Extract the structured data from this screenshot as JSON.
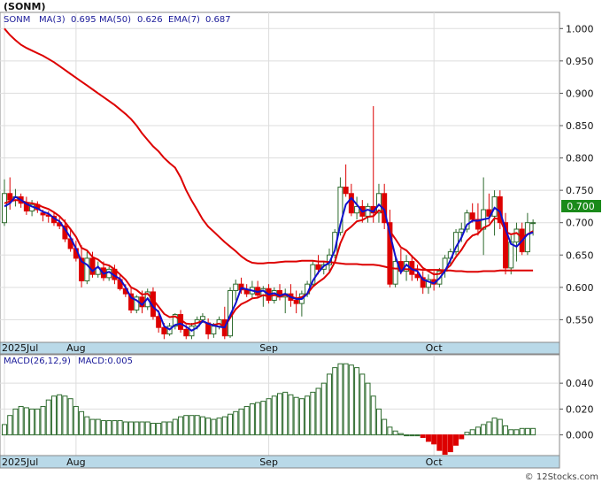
{
  "header": {
    "symbol": "(SONM)",
    "legend_ticker": "SONM",
    "ma3_label": "MA(3)",
    "ma3_value": "0.695",
    "ma50_label": "MA(50)",
    "ma50_value": "0.626",
    "ema7_label": "EMA(7)",
    "ema7_value": "0.687"
  },
  "macd_header": {
    "params": "MACD(26,12,9)",
    "value_label": "MACD:0.005"
  },
  "last_price_badge": "0.700",
  "watermark": "© 12Stocks.com",
  "colors": {
    "up_candle": "#2e6b2e",
    "down_candle": "#dd0000",
    "ma3": "#1111cc",
    "ma50": "#dd0000",
    "ema7": "#dd0000",
    "axis_band": "#b9d9e8",
    "badge": "#1a8a1a"
  },
  "chart_data": [
    {
      "type": "candlestick",
      "title": "",
      "y_ticks": [
        "1.000",
        "0.950",
        "0.900",
        "0.850",
        "0.800",
        "0.750",
        "0.700",
        "0.650",
        "0.600",
        "0.550"
      ],
      "ylim": [
        0.515,
        1.025
      ],
      "x_ticks": [
        "2025Jul",
        "Aug",
        "Sep",
        "Oct"
      ],
      "x_tick_index": [
        0,
        13,
        48,
        78
      ],
      "n": 97,
      "ohlc": [
        [
          0.7,
          0.767,
          0.695,
          0.745
        ],
        [
          0.745,
          0.77,
          0.72,
          0.735
        ],
        [
          0.735,
          0.752,
          0.725,
          0.74
        ],
        [
          0.74,
          0.745,
          0.723,
          0.73
        ],
        [
          0.73,
          0.74,
          0.712,
          0.718
        ],
        [
          0.718,
          0.735,
          0.71,
          0.728
        ],
        [
          0.728,
          0.733,
          0.715,
          0.72
        ],
        [
          0.715,
          0.72,
          0.702,
          0.712
        ],
        [
          0.712,
          0.718,
          0.7,
          0.71
        ],
        [
          0.71,
          0.715,
          0.695,
          0.7
        ],
        [
          0.7,
          0.708,
          0.69,
          0.695
        ],
        [
          0.695,
          0.705,
          0.67,
          0.675
        ],
        [
          0.675,
          0.69,
          0.655,
          0.66
        ],
        [
          0.66,
          0.672,
          0.64,
          0.645
        ],
        [
          0.645,
          0.665,
          0.6,
          0.61
        ],
        [
          0.61,
          0.655,
          0.605,
          0.645
        ],
        [
          0.645,
          0.655,
          0.615,
          0.62
        ],
        [
          0.62,
          0.64,
          0.615,
          0.63
        ],
        [
          0.63,
          0.64,
          0.61,
          0.615
        ],
        [
          0.615,
          0.632,
          0.61,
          0.628
        ],
        [
          0.628,
          0.635,
          0.605,
          0.612
        ],
        [
          0.612,
          0.62,
          0.595,
          0.598
        ],
        [
          0.598,
          0.605,
          0.585,
          0.59
        ],
        [
          0.59,
          0.6,
          0.56,
          0.565
        ],
        [
          0.565,
          0.588,
          0.56,
          0.585
        ],
        [
          0.585,
          0.595,
          0.56,
          0.57
        ],
        [
          0.57,
          0.598,
          0.565,
          0.593
        ],
        [
          0.593,
          0.6,
          0.55,
          0.555
        ],
        [
          0.555,
          0.565,
          0.53,
          0.538
        ],
        [
          0.538,
          0.545,
          0.52,
          0.528
        ],
        [
          0.528,
          0.545,
          0.525,
          0.54
        ],
        [
          0.54,
          0.56,
          0.535,
          0.558
        ],
        [
          0.558,
          0.565,
          0.53,
          0.535
        ],
        [
          0.535,
          0.542,
          0.52,
          0.525
        ],
        [
          0.525,
          0.545,
          0.52,
          0.54
        ],
        [
          0.54,
          0.555,
          0.535,
          0.55
        ],
        [
          0.55,
          0.56,
          0.545,
          0.555
        ],
        [
          0.545,
          0.552,
          0.52,
          0.528
        ],
        [
          0.528,
          0.545,
          0.522,
          0.54
        ],
        [
          0.54,
          0.555,
          0.535,
          0.55
        ],
        [
          0.55,
          0.57,
          0.52,
          0.525
        ],
        [
          0.525,
          0.6,
          0.522,
          0.595
        ],
        [
          0.595,
          0.612,
          0.58,
          0.605
        ],
        [
          0.605,
          0.615,
          0.59,
          0.596
        ],
        [
          0.596,
          0.605,
          0.585,
          0.59
        ],
        [
          0.59,
          0.61,
          0.582,
          0.6
        ],
        [
          0.6,
          0.61,
          0.585,
          0.588
        ],
        [
          0.588,
          0.602,
          0.57,
          0.598
        ],
        [
          0.598,
          0.605,
          0.575,
          0.58
        ],
        [
          0.58,
          0.6,
          0.575,
          0.595
        ],
        [
          0.595,
          0.605,
          0.58,
          0.585
        ],
        [
          0.585,
          0.598,
          0.56,
          0.59
        ],
        [
          0.59,
          0.605,
          0.57,
          0.58
        ],
        [
          0.58,
          0.595,
          0.56,
          0.575
        ],
        [
          0.575,
          0.595,
          0.555,
          0.59
        ],
        [
          0.59,
          0.61,
          0.585,
          0.605
        ],
        [
          0.605,
          0.64,
          0.6,
          0.635
        ],
        [
          0.635,
          0.65,
          0.62,
          0.628
        ],
        [
          0.628,
          0.64,
          0.62,
          0.635
        ],
        [
          0.635,
          0.66,
          0.625,
          0.65
        ],
        [
          0.65,
          0.69,
          0.645,
          0.685
        ],
        [
          0.685,
          0.77,
          0.68,
          0.755
        ],
        [
          0.755,
          0.79,
          0.74,
          0.745
        ],
        [
          0.745,
          0.76,
          0.71,
          0.715
        ],
        [
          0.715,
          0.74,
          0.705,
          0.725
        ],
        [
          0.725,
          0.735,
          0.7,
          0.71
        ],
        [
          0.71,
          0.73,
          0.7,
          0.725
        ],
        [
          0.725,
          0.88,
          0.7,
          0.715
        ],
        [
          0.715,
          0.76,
          0.7,
          0.745
        ],
        [
          0.745,
          0.76,
          0.69,
          0.7
        ],
        [
          0.7,
          0.72,
          0.6,
          0.605
        ],
        [
          0.605,
          0.65,
          0.6,
          0.64
        ],
        [
          0.64,
          0.66,
          0.62,
          0.625
        ],
        [
          0.625,
          0.65,
          0.61,
          0.64
        ],
        [
          0.64,
          0.65,
          0.61,
          0.62
        ],
        [
          0.62,
          0.635,
          0.61,
          0.615
        ],
        [
          0.615,
          0.625,
          0.59,
          0.6
        ],
        [
          0.6,
          0.62,
          0.59,
          0.612
        ],
        [
          0.612,
          0.625,
          0.595,
          0.605
        ],
        [
          0.605,
          0.63,
          0.6,
          0.625
        ],
        [
          0.625,
          0.65,
          0.615,
          0.645
        ],
        [
          0.645,
          0.66,
          0.635,
          0.655
        ],
        [
          0.655,
          0.69,
          0.65,
          0.685
        ],
        [
          0.685,
          0.7,
          0.67,
          0.69
        ],
        [
          0.69,
          0.72,
          0.685,
          0.715
        ],
        [
          0.715,
          0.73,
          0.7,
          0.705
        ],
        [
          0.705,
          0.73,
          0.68,
          0.69
        ],
        [
          0.69,
          0.77,
          0.65,
          0.72
        ],
        [
          0.72,
          0.745,
          0.7,
          0.71
        ],
        [
          0.71,
          0.75,
          0.68,
          0.74
        ],
        [
          0.74,
          0.75,
          0.69,
          0.7
        ],
        [
          0.7,
          0.715,
          0.62,
          0.63
        ],
        [
          0.63,
          0.68,
          0.62,
          0.67
        ],
        [
          0.67,
          0.7,
          0.64,
          0.69
        ],
        [
          0.69,
          0.7,
          0.65,
          0.655
        ],
        [
          0.655,
          0.715,
          0.65,
          0.7
        ],
        [
          0.7,
          0.705,
          0.68,
          0.7
        ]
      ],
      "ma3": [
        0.725,
        0.73,
        0.74,
        0.735,
        0.729,
        0.725,
        0.722,
        0.717,
        0.714,
        0.707,
        0.702,
        0.69,
        0.677,
        0.66,
        0.64,
        0.635,
        0.625,
        0.632,
        0.621,
        0.624,
        0.618,
        0.613,
        0.6,
        0.584,
        0.58,
        0.573,
        0.583,
        0.57,
        0.562,
        0.54,
        0.535,
        0.542,
        0.544,
        0.539,
        0.533,
        0.538,
        0.548,
        0.544,
        0.541,
        0.539,
        0.538,
        0.557,
        0.575,
        0.599,
        0.597,
        0.595,
        0.593,
        0.595,
        0.589,
        0.591,
        0.587,
        0.59,
        0.585,
        0.582,
        0.582,
        0.59,
        0.61,
        0.623,
        0.633,
        0.638,
        0.657,
        0.697,
        0.728,
        0.738,
        0.728,
        0.717,
        0.72,
        0.717,
        0.728,
        0.72,
        0.683,
        0.648,
        0.623,
        0.635,
        0.628,
        0.625,
        0.612,
        0.609,
        0.606,
        0.614,
        0.625,
        0.642,
        0.662,
        0.677,
        0.697,
        0.703,
        0.703,
        0.705,
        0.707,
        0.723,
        0.717,
        0.69,
        0.667,
        0.663,
        0.672,
        0.682,
        0.685
      ],
      "ma50": [
        1.0,
        0.99,
        0.982,
        0.975,
        0.97,
        0.966,
        0.962,
        0.958,
        0.953,
        0.948,
        0.942,
        0.936,
        0.93,
        0.924,
        0.918,
        0.912,
        0.906,
        0.9,
        0.894,
        0.888,
        0.882,
        0.875,
        0.868,
        0.86,
        0.85,
        0.838,
        0.828,
        0.818,
        0.81,
        0.8,
        0.792,
        0.785,
        0.77,
        0.75,
        0.734,
        0.72,
        0.705,
        0.694,
        0.686,
        0.678,
        0.67,
        0.663,
        0.656,
        0.648,
        0.642,
        0.638,
        0.637,
        0.637,
        0.638,
        0.638,
        0.639,
        0.64,
        0.64,
        0.64,
        0.641,
        0.641,
        0.641,
        0.64,
        0.64,
        0.639,
        0.638,
        0.637,
        0.636,
        0.636,
        0.636,
        0.635,
        0.635,
        0.635,
        0.634,
        0.632,
        0.63,
        0.629,
        0.629,
        0.628,
        0.628,
        0.628,
        0.627,
        0.627,
        0.627,
        0.627,
        0.626,
        0.626,
        0.625,
        0.625,
        0.624,
        0.624,
        0.624,
        0.625,
        0.625,
        0.625,
        0.626,
        0.626,
        0.626,
        0.626,
        0.626,
        0.626,
        0.626
      ],
      "ema7": [
        0.73,
        0.733,
        0.735,
        0.734,
        0.731,
        0.73,
        0.728,
        0.724,
        0.721,
        0.716,
        0.71,
        0.701,
        0.69,
        0.678,
        0.661,
        0.657,
        0.647,
        0.643,
        0.636,
        0.634,
        0.628,
        0.62,
        0.612,
        0.6,
        0.596,
        0.589,
        0.59,
        0.581,
        0.57,
        0.559,
        0.554,
        0.555,
        0.55,
        0.544,
        0.543,
        0.545,
        0.548,
        0.543,
        0.542,
        0.544,
        0.539,
        0.553,
        0.566,
        0.574,
        0.578,
        0.583,
        0.584,
        0.588,
        0.586,
        0.588,
        0.587,
        0.588,
        0.586,
        0.583,
        0.585,
        0.59,
        0.601,
        0.608,
        0.614,
        0.623,
        0.639,
        0.668,
        0.687,
        0.694,
        0.702,
        0.704,
        0.709,
        0.71,
        0.719,
        0.714,
        0.687,
        0.675,
        0.662,
        0.657,
        0.648,
        0.64,
        0.63,
        0.625,
        0.62,
        0.621,
        0.627,
        0.634,
        0.647,
        0.658,
        0.672,
        0.68,
        0.683,
        0.692,
        0.696,
        0.707,
        0.705,
        0.686,
        0.682,
        0.684,
        0.677,
        0.682,
        0.687
      ]
    },
    {
      "type": "bar",
      "title": "",
      "y_ticks": [
        "0.040",
        "0.020",
        "0.000"
      ],
      "ylim": [
        -0.016,
        0.062
      ],
      "x_ticks": [
        "2025Jul",
        "Aug",
        "Sep",
        "Oct"
      ],
      "x_tick_index": [
        0,
        13,
        48,
        78
      ],
      "values": [
        0.008,
        0.015,
        0.02,
        0.022,
        0.021,
        0.02,
        0.02,
        0.022,
        0.027,
        0.03,
        0.031,
        0.03,
        0.028,
        0.022,
        0.018,
        0.014,
        0.012,
        0.012,
        0.011,
        0.011,
        0.011,
        0.011,
        0.01,
        0.01,
        0.01,
        0.01,
        0.01,
        0.009,
        0.009,
        0.01,
        0.01,
        0.012,
        0.014,
        0.015,
        0.015,
        0.015,
        0.014,
        0.013,
        0.012,
        0.013,
        0.014,
        0.016,
        0.018,
        0.02,
        0.022,
        0.024,
        0.025,
        0.026,
        0.028,
        0.03,
        0.032,
        0.033,
        0.031,
        0.029,
        0.028,
        0.03,
        0.033,
        0.036,
        0.04,
        0.047,
        0.052,
        0.055,
        0.055,
        0.054,
        0.052,
        0.047,
        0.04,
        0.03,
        0.02,
        0.012,
        0.006,
        0.003,
        0.001,
        0.0,
        0.0,
        0.0,
        -0.002,
        -0.005,
        -0.007,
        -0.012,
        -0.015,
        -0.013,
        -0.008,
        -0.003,
        0.002,
        0.004,
        0.006,
        0.008,
        0.01,
        0.013,
        0.012,
        0.007,
        0.004,
        0.004,
        0.005,
        0.005,
        0.005
      ]
    }
  ]
}
